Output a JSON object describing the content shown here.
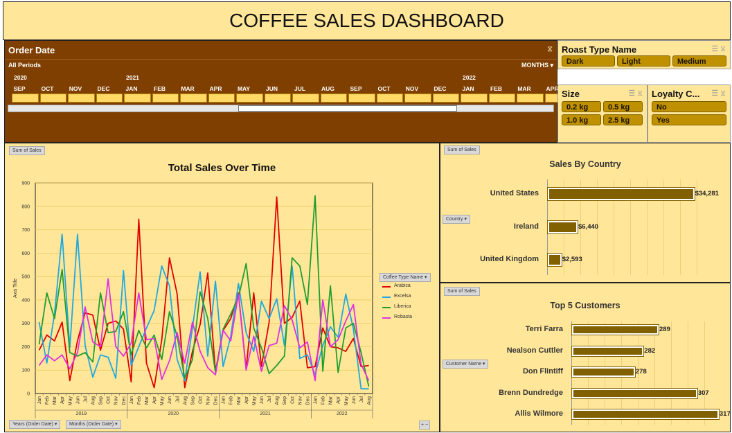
{
  "dashboard_title": "COFFEE SALES DASHBOARD",
  "timeline": {
    "title": "Order Date",
    "period_label": "All Periods",
    "level_label": "MONTHS",
    "years": [
      {
        "label": "2020",
        "index": 0
      },
      {
        "label": "2021",
        "index": 4
      },
      {
        "label": "2022",
        "index": 16
      }
    ],
    "months": [
      "SEP",
      "OCT",
      "NOV",
      "DEC",
      "JAN",
      "FEB",
      "MAR",
      "APR",
      "MAY",
      "JUN",
      "JUL",
      "AUG",
      "SEP",
      "OCT",
      "NOV",
      "DEC",
      "JAN",
      "FEB",
      "MAR",
      "APR"
    ]
  },
  "slicers": {
    "roast": {
      "title": "Roast Type Name",
      "items": [
        "Dark",
        "Light",
        "Medium"
      ]
    },
    "size": {
      "title": "Size",
      "items": [
        "0.2 kg",
        "0.5 kg",
        "1.0 kg",
        "2.5 kg"
      ]
    },
    "loyalty": {
      "title": "Loyalty C...",
      "items": [
        "No",
        "Yes"
      ]
    }
  },
  "field_buttons": {
    "sum_of_sales": "Sum of Sales",
    "years": "Years (Order Date)",
    "months": "Months (Order Date)",
    "country": "Country",
    "customer": "Customer Name",
    "coffee_type": "Coffee Type Name"
  },
  "chart_data": [
    {
      "type": "line",
      "title": "Total Sales Over Time",
      "xlabel": "",
      "ylabel": "Axis Title",
      "ylim": [
        0,
        900
      ],
      "yticks": [
        0,
        100,
        200,
        300,
        400,
        500,
        600,
        700,
        800,
        900
      ],
      "x": [
        "Jan",
        "Feb",
        "Mar",
        "Apr",
        "May",
        "Jun",
        "Jul",
        "Aug",
        "Sep",
        "Oct",
        "Nov",
        "Dec",
        "Jan",
        "Feb",
        "Mar",
        "Apr",
        "May",
        "Jun",
        "Jul",
        "Aug",
        "Sep",
        "Oct",
        "Nov",
        "Dec",
        "Jan",
        "Feb",
        "Mar",
        "Apr",
        "May",
        "Jun",
        "Jul",
        "Aug",
        "Sep",
        "Oct",
        "Nov",
        "Dec",
        "Jan",
        "Feb",
        "Mar",
        "Apr",
        "May",
        "Jun",
        "Jul",
        "Aug"
      ],
      "year_groups": [
        {
          "label": "2019",
          "count": 12
        },
        {
          "label": "2020",
          "count": 12
        },
        {
          "label": "2021",
          "count": 12
        },
        {
          "label": "2022",
          "count": 8
        }
      ],
      "series": [
        {
          "name": "Arabica",
          "color": "#e00000",
          "values": [
            185,
            250,
            225,
            305,
            55,
            225,
            345,
            335,
            185,
            300,
            310,
            275,
            50,
            745,
            130,
            25,
            230,
            580,
            425,
            25,
            180,
            295,
            515,
            95,
            270,
            320,
            430,
            105,
            430,
            115,
            305,
            840,
            300,
            325,
            395,
            110,
            115,
            280,
            200,
            195,
            180,
            235,
            115,
            120
          ]
        },
        {
          "name": "Excelsa",
          "color": "#1fa8e0",
          "values": [
            305,
            130,
            340,
            680,
            195,
            680,
            205,
            70,
            165,
            155,
            65,
            525,
            120,
            200,
            280,
            355,
            545,
            460,
            145,
            55,
            280,
            520,
            160,
            480,
            115,
            245,
            470,
            260,
            180,
            395,
            320,
            405,
            205,
            545,
            150,
            165,
            80,
            205,
            285,
            240,
            425,
            275,
            20,
            20
          ]
        },
        {
          "name": "Liberica",
          "color": "#1f9e30",
          "values": [
            210,
            430,
            320,
            530,
            175,
            160,
            175,
            135,
            430,
            260,
            265,
            350,
            165,
            270,
            195,
            250,
            145,
            350,
            245,
            65,
            145,
            435,
            320,
            90,
            275,
            340,
            410,
            555,
            280,
            195,
            85,
            120,
            160,
            580,
            545,
            380,
            845,
            95,
            460,
            90,
            280,
            300,
            175,
            30
          ]
        },
        {
          "name": "Robasta",
          "color": "#e030e0",
          "values": [
            120,
            165,
            140,
            165,
            105,
            175,
            370,
            220,
            200,
            490,
            200,
            160,
            215,
            430,
            230,
            235,
            60,
            140,
            260,
            130,
            305,
            180,
            110,
            80,
            270,
            225,
            425,
            100,
            245,
            95,
            205,
            215,
            375,
            315,
            195,
            220,
            55,
            400,
            200,
            230,
            310,
            380,
            125,
            55
          ]
        }
      ]
    },
    {
      "type": "bar",
      "title": "Sales By Country",
      "categories": [
        "United States",
        "Ireland",
        "United Kingdom"
      ],
      "values": [
        34281,
        6440,
        2593
      ],
      "value_labels": [
        "$34,281",
        "$6,440",
        "$2,593"
      ],
      "xlim": [
        0,
        36000
      ]
    },
    {
      "type": "bar",
      "title": "Top 5 Customers",
      "categories": [
        "Terri Farra",
        "Nealson Cuttler",
        "Don Flintiff",
        "Brenn Dundredge",
        "Allis Wilmore"
      ],
      "values": [
        289,
        282,
        278,
        307,
        317
      ],
      "value_labels": [
        "289",
        "282",
        "278",
        "307",
        "317"
      ],
      "xlim": [
        250,
        318
      ]
    }
  ]
}
